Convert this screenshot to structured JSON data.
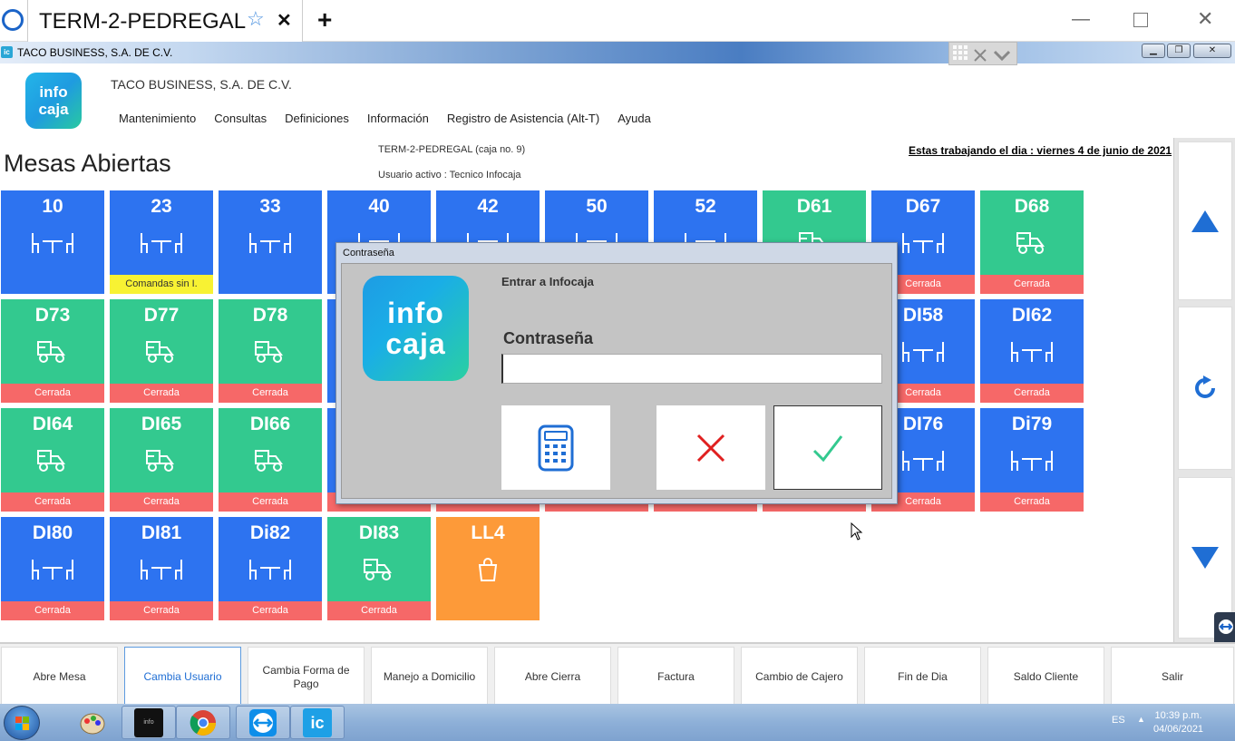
{
  "teamviewer": {
    "tab_title": "TERM-2-PEDREGAL",
    "add_tab": "+"
  },
  "window": {
    "title": "TACO BUSINESS, S.A. DE C.V.",
    "min": "▁",
    "max": "❐",
    "close": "✕"
  },
  "header": {
    "company": "TACO BUSINESS, S.A. DE C.V.",
    "logo_line1": "info",
    "logo_line2": "caja",
    "menu": [
      "Mantenimiento",
      "Consultas",
      "Definiciones",
      "Información",
      "Registro de Asistencia (Alt-T)",
      "Ayuda"
    ],
    "page_title": "Mesas Abiertas",
    "terminal": "TERM-2-PEDREGAL (caja no. 9)",
    "user": "Usuario activo : Tecnico Infocaja",
    "date": "Estas trabajando el dia : viernes 4 de junio de 2021"
  },
  "tables": [
    {
      "num": "10",
      "color": "blue",
      "icon": "table-icon",
      "status": ""
    },
    {
      "num": "23",
      "color": "blue",
      "icon": "table-icon",
      "status": "Comandas sin I.",
      "status_color": "yellow"
    },
    {
      "num": "33",
      "color": "blue",
      "icon": "table-icon",
      "status": ""
    },
    {
      "num": "40",
      "color": "blue",
      "icon": "table-icon",
      "status": ""
    },
    {
      "num": "42",
      "color": "blue",
      "icon": "table-icon",
      "status": ""
    },
    {
      "num": "50",
      "color": "blue",
      "icon": "table-icon",
      "status": ""
    },
    {
      "num": "52",
      "color": "blue",
      "icon": "table-icon",
      "status": ""
    },
    {
      "num": "D61",
      "color": "green",
      "icon": "delivery-icon",
      "status": ""
    },
    {
      "num": "D67",
      "color": "blue",
      "icon": "table-icon",
      "status": "Cerrada",
      "status_color": "red"
    },
    {
      "num": "D68",
      "color": "green",
      "icon": "delivery-icon",
      "status": "Cerrada",
      "status_color": "red"
    },
    {
      "num": "D73",
      "color": "green",
      "icon": "delivery-icon",
      "status": "Cerrada",
      "status_color": "red"
    },
    {
      "num": "D77",
      "color": "green",
      "icon": "delivery-icon",
      "status": "Cerrada",
      "status_color": "red"
    },
    {
      "num": "D78",
      "color": "green",
      "icon": "delivery-icon",
      "status": "Cerrada",
      "status_color": "red"
    },
    {
      "num": "",
      "color": "blue",
      "icon": "",
      "status": ""
    },
    {
      "num": "",
      "color": "blue",
      "icon": "",
      "status": ""
    },
    {
      "num": "",
      "color": "blue",
      "icon": "",
      "status": ""
    },
    {
      "num": "",
      "color": "blue",
      "icon": "",
      "status": ""
    },
    {
      "num": "",
      "color": "blue",
      "icon": "",
      "status": ""
    },
    {
      "num": "DI58",
      "color": "blue",
      "icon": "table-icon",
      "status": "Cerrada",
      "status_color": "red"
    },
    {
      "num": "DI62",
      "color": "blue",
      "icon": "table-icon",
      "status": "Cerrada",
      "status_color": "red"
    },
    {
      "num": "DI64",
      "color": "green",
      "icon": "delivery-icon",
      "status": "Cerrada",
      "status_color": "red"
    },
    {
      "num": "DI65",
      "color": "green",
      "icon": "delivery-icon",
      "status": "Cerrada",
      "status_color": "red"
    },
    {
      "num": "DI66",
      "color": "green",
      "icon": "delivery-icon",
      "status": "Cerrada",
      "status_color": "red"
    },
    {
      "num": "",
      "color": "blue",
      "icon": "",
      "status": "",
      "status_color": "red"
    },
    {
      "num": "",
      "color": "blue",
      "icon": "",
      "status": "",
      "status_color": "red"
    },
    {
      "num": "",
      "color": "blue",
      "icon": "",
      "status": "",
      "status_color": "red"
    },
    {
      "num": "",
      "color": "blue",
      "icon": "",
      "status": "",
      "status_color": "red"
    },
    {
      "num": "",
      "color": "blue",
      "icon": "",
      "status": "",
      "status_color": "red"
    },
    {
      "num": "DI76",
      "color": "blue",
      "icon": "table-icon",
      "status": "Cerrada",
      "status_color": "red"
    },
    {
      "num": "Di79",
      "color": "blue",
      "icon": "table-icon",
      "status": "Cerrada",
      "status_color": "red"
    },
    {
      "num": "DI80",
      "color": "blue",
      "icon": "table-icon",
      "status": "Cerrada",
      "status_color": "red"
    },
    {
      "num": "DI81",
      "color": "blue",
      "icon": "table-icon",
      "status": "Cerrada",
      "status_color": "red"
    },
    {
      "num": "Di82",
      "color": "blue",
      "icon": "table-icon",
      "status": "Cerrada",
      "status_color": "red"
    },
    {
      "num": "DI83",
      "color": "green",
      "icon": "delivery-icon",
      "status": "Cerrada",
      "status_color": "red"
    },
    {
      "num": "LL4",
      "color": "orange",
      "icon": "bag-icon",
      "status": ""
    }
  ],
  "colors": {
    "blue": "#2d73f0",
    "green": "#33c98f",
    "orange": "#fd9a39",
    "red": "#f66868",
    "yellow": "#f8f233"
  },
  "scroll": {
    "up": "arrow-up-icon",
    "refresh": "refresh-icon",
    "down": "arrow-down-icon"
  },
  "bottom_buttons": [
    {
      "label": "Abre Mesa",
      "active": false
    },
    {
      "label": "Cambia Usuario",
      "active": true
    },
    {
      "label": "Cambia Forma de Pago",
      "active": false
    },
    {
      "label": "Manejo a Domicilio",
      "active": false
    },
    {
      "label": "Abre Cierra",
      "active": false
    },
    {
      "label": "Factura",
      "active": false
    },
    {
      "label": "Cambio de Cajero",
      "active": false
    },
    {
      "label": "Fin de Dia",
      "active": false
    },
    {
      "label": "Saldo Cliente",
      "active": false
    },
    {
      "label": "Salir",
      "active": false
    }
  ],
  "dialog": {
    "caption": "Contraseña",
    "header": "Entrar a Infocaja",
    "label": "Contraseña",
    "value": "",
    "logo_line1": "info",
    "logo_line2": "caja"
  },
  "taskbar": {
    "lang": "ES",
    "time": "10:39 p.m.",
    "date": "04/06/2021",
    "ic_label": "ic"
  }
}
